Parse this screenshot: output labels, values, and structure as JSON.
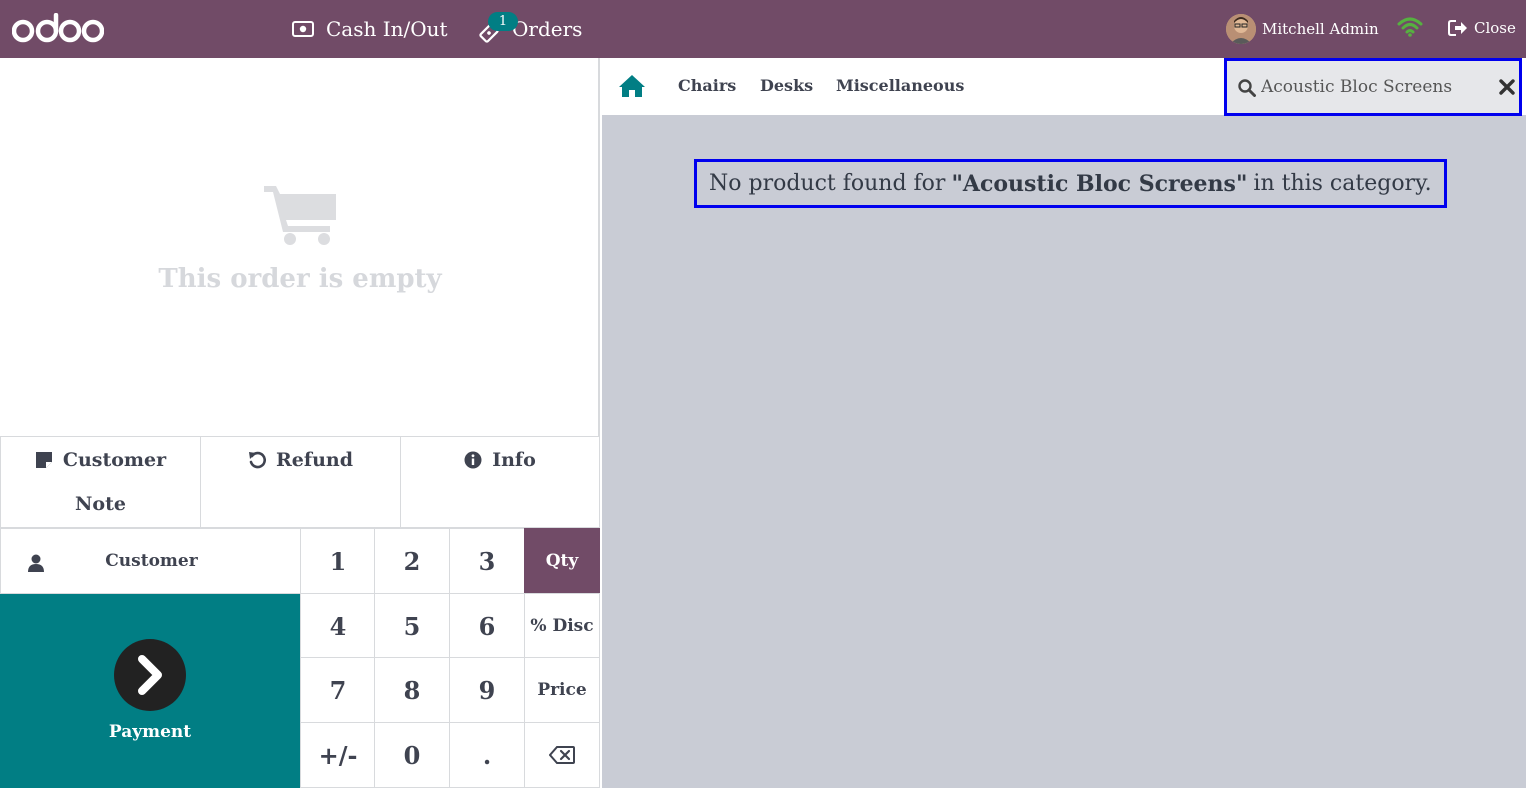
{
  "header": {
    "brand": "odoo",
    "cash_label": "Cash In/Out",
    "orders_label": "Orders",
    "orders_count": "1",
    "user_name": "Mitchell Admin",
    "close_label": "Close",
    "colors": {
      "bar": "#714b67",
      "badge": "#017e84",
      "wifi": "#56b140"
    }
  },
  "order": {
    "empty_text": "This order is empty"
  },
  "controls": {
    "note_line1": "Customer",
    "note_line2": "Note",
    "refund_label": "Refund",
    "info_label": "Info",
    "customer_label": "Customer",
    "payment_label": "Payment"
  },
  "numpad": {
    "k1": "1",
    "k2": "2",
    "k3": "3",
    "qty": "Qty",
    "k4": "4",
    "k5": "5",
    "k6": "6",
    "disc": "% Disc",
    "k7": "7",
    "k8": "8",
    "k9": "9",
    "price": "Price",
    "sign": "+/-",
    "k0": "0",
    "dot": ".",
    "active_mode": "Qty",
    "backspace_icon": "backspace-icon"
  },
  "categories": {
    "items": [
      "Chairs",
      "Desks",
      "Miscellaneous"
    ]
  },
  "search": {
    "value": "Acoustic Bloc Screens"
  },
  "results": {
    "prefix": "No product found for",
    "query": "\"Acoustic Bloc Screens\"",
    "suffix": "in this category."
  }
}
